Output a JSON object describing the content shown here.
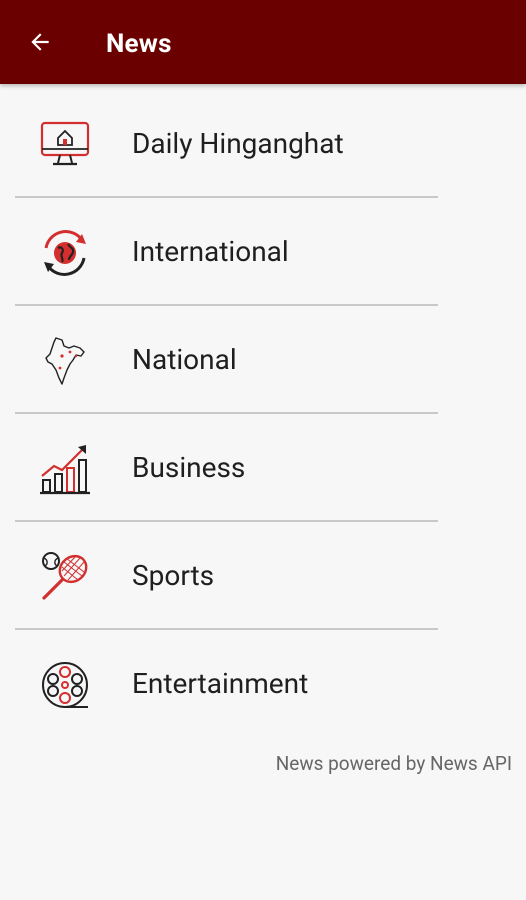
{
  "appbar": {
    "title": "News",
    "back_icon": "arrow-left-icon",
    "color": "#6b0000"
  },
  "categories": [
    {
      "label": "Daily Hinganghat",
      "icon": "monitor-home-icon"
    },
    {
      "label": "International",
      "icon": "globe-refresh-icon"
    },
    {
      "label": "National",
      "icon": "india-map-icon"
    },
    {
      "label": "Business",
      "icon": "growth-chart-icon"
    },
    {
      "label": "Sports",
      "icon": "tennis-racket-icon"
    },
    {
      "label": "Entertainment",
      "icon": "film-reel-icon"
    }
  ],
  "footer": {
    "text": "News powered by News API"
  },
  "colors": {
    "accent_red": "#d32f2f",
    "icon_dark": "#222222"
  }
}
